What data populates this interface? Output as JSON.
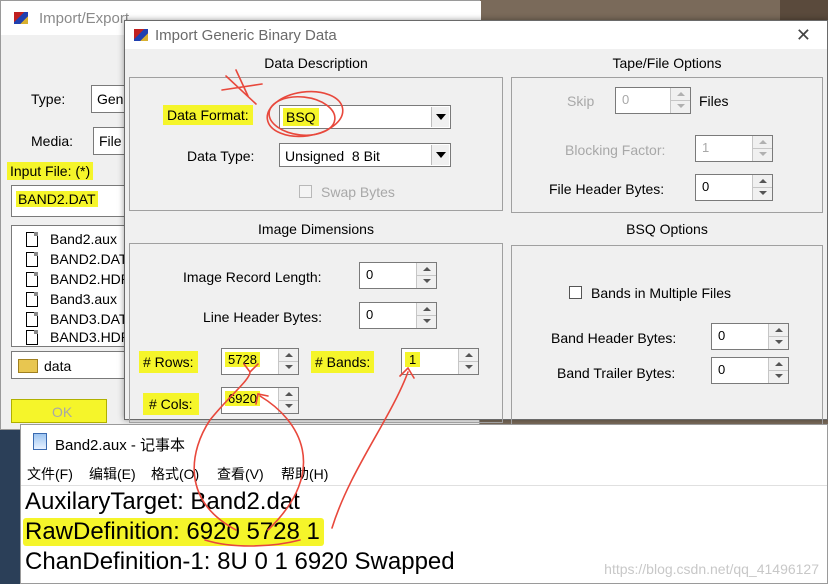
{
  "import_export": {
    "title": "Import/Export",
    "type_label": "Type:",
    "type_value": "Gene",
    "media_label": "Media:",
    "media_value": "File",
    "input_file_label": "Input File: (*)",
    "input_file_value": "BAND2.DAT",
    "files": [
      "Band2.aux",
      "BAND2.DAT",
      "BAND2.HDR",
      "Band3.aux",
      "BAND3.DAT",
      "BAND3.HDR"
    ],
    "folder": "data",
    "ok_label": "OK"
  },
  "dialog": {
    "title": "Import Generic Binary Data",
    "close_label": "✕",
    "data_description": {
      "header": "Data Description",
      "data_format_label": "Data Format:",
      "data_format_value": "BSQ",
      "data_type_label": "Data Type:",
      "data_type_value": "Unsigned  8 Bit",
      "swap_bytes_label": "Swap Bytes"
    },
    "tape_file_options": {
      "header": "Tape/File Options",
      "skip_label": "Skip",
      "skip_value": "0",
      "files_label": "Files",
      "blocking_factor_label": "Blocking Factor:",
      "blocking_factor_value": "1",
      "file_header_bytes_label": "File Header Bytes:",
      "file_header_bytes_value": "0"
    },
    "image_dimensions": {
      "header": "Image Dimensions",
      "image_record_length_label": "Image Record Length:",
      "image_record_length_value": "0",
      "line_header_bytes_label": "Line Header Bytes:",
      "line_header_bytes_value": "0",
      "rows_label": "# Rows:",
      "rows_value": "5728",
      "bands_label": "# Bands:",
      "bands_value": "1",
      "cols_label": "# Cols:",
      "cols_value": "6920"
    },
    "bsq_options": {
      "header": "BSQ Options",
      "bands_multiple_files_label": "Bands in Multiple Files",
      "band_header_bytes_label": "Band Header Bytes:",
      "band_header_bytes_value": "0",
      "band_trailer_bytes_label": "Band Trailer Bytes:",
      "band_trailer_bytes_value": "0"
    }
  },
  "notepad": {
    "title": "Band2.aux - 记事本",
    "menu": [
      "文件(F)",
      "编辑(E)",
      "格式(O)",
      "查看(V)",
      "帮助(H)"
    ],
    "lines": [
      "AuxilaryTarget: Band2.dat",
      "RawDefinition: 6920 5728 1",
      "ChanDefinition-1: 8U 0 1 6920 Swapped"
    ],
    "watermark": "https://blog.csdn.net/qq_41496127"
  },
  "colors": {
    "highlight": "#f5f52a",
    "annotation": "#e8483c"
  }
}
